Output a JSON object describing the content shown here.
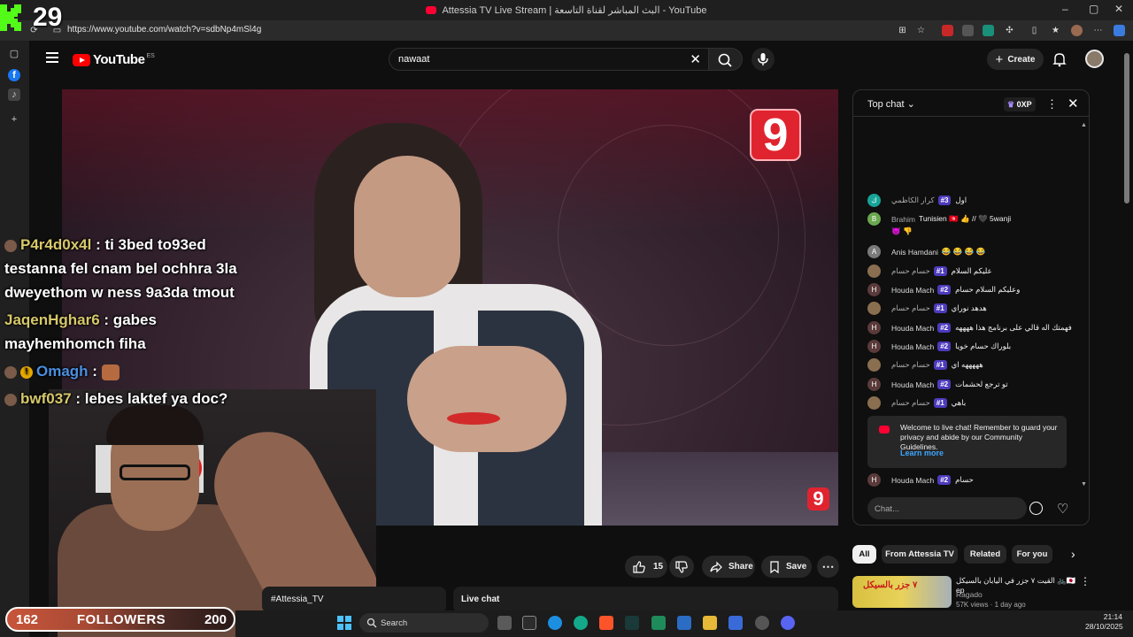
{
  "browser": {
    "tab_title": "Attessia TV Live Stream | البث المباشر لقناة التاسعة - YouTube",
    "url": "https://www.youtube.com/watch?v=sdbNp4mSl4g",
    "window_controls": [
      "–",
      "▢",
      "✕"
    ]
  },
  "youtube": {
    "logo_text": "YouTube",
    "region": "ES",
    "search_value": "nawaat",
    "create_label": "Create"
  },
  "video": {
    "channel_logo": "9"
  },
  "overlay": {
    "top_count": "29",
    "messages": [
      {
        "user": "P4r4d0x4l",
        "text": " : ti 3bed to93ed"
      },
      {
        "line": "testanna fel cnam bel ochhra 3la"
      },
      {
        "line": "dweyethom w ness 9a3da tmout"
      },
      {
        "user": "JaqenHghar6",
        "text": " : gabes"
      },
      {
        "line": "mayhemhomch fiha"
      },
      {
        "user": "Omagh",
        "text": " : "
      },
      {
        "user": "bwf037",
        "text": " : lebes laktef ya doc?"
      }
    ],
    "followers": {
      "current": "162",
      "label": "FOLLOWERS",
      "goal": "200"
    }
  },
  "below_video": {
    "like_count": "15",
    "share_label": "Share",
    "save_label": "Save",
    "hashtag": "#Attessia_TV",
    "live_chat_label": "Live chat"
  },
  "chat": {
    "mode_label": "Top chat",
    "xp_label": "0XP",
    "messages": [
      {
        "avatar": "ك",
        "avatar_color": "#17a398",
        "name": "كرار الكاظمي",
        "rank": "#3",
        "text": "اول"
      },
      {
        "avatar": "B",
        "avatar_color": "#6aa84f",
        "name": "Brahim",
        "rank": "",
        "text": "Tunisien 🇹🇳 👍 // 🖤 5wanji"
      },
      {
        "avatar": "",
        "avatar_color": "",
        "name": "",
        "rank": "",
        "text": "😈 👎"
      },
      {
        "avatar": "A",
        "avatar_color": "#7a7a7a",
        "name": "Anis Hamdani",
        "rank": "",
        "text": "😂 😂 😂 😂"
      },
      {
        "avatar": "",
        "avatar_color": "#8a6e50",
        "name": "حسام حسام",
        "rank": "#1",
        "text": "عليكم السلام"
      },
      {
        "avatar": "H",
        "avatar_color": "#5a3a3a",
        "name": "Houda Mach",
        "rank": "#2",
        "text": "وعليكم السلام حسام"
      },
      {
        "avatar": "",
        "avatar_color": "#8a6e50",
        "name": "حسام حسام",
        "rank": "#1",
        "text": "هدهد نوراي"
      },
      {
        "avatar": "H",
        "avatar_color": "#5a3a3a",
        "name": "Houda Mach",
        "rank": "#2",
        "text": "فهمتك اله قالي على برنامج هذا ههههه"
      },
      {
        "avatar": "H",
        "avatar_color": "#5a3a3a",
        "name": "Houda Mach",
        "rank": "#2",
        "text": "بلوراك حسام خويا"
      },
      {
        "avatar": "",
        "avatar_color": "#8a6e50",
        "name": "حسام حسام",
        "rank": "#1",
        "text": "هههههه اي"
      },
      {
        "avatar": "H",
        "avatar_color": "#5a3a3a",
        "name": "Houda Mach",
        "rank": "#2",
        "text": "تو ترجع لحشمات"
      },
      {
        "avatar": "",
        "avatar_color": "#8a6e50",
        "name": "حسام حسام",
        "rank": "#1",
        "text": "باهي"
      }
    ],
    "welcome_text": "Welcome to live chat! Remember to guard your privacy and abide by our Community Guidelines.",
    "learn_more": "Learn more",
    "last_message": {
      "avatar": "H",
      "name": "Houda Mach",
      "rank": "#2",
      "text": "حسام"
    },
    "input_placeholder": "Chat..."
  },
  "chips": [
    "All",
    "From Attessia TV",
    "Related",
    "For you"
  ],
  "recommended": {
    "thumb_text": "٧ جزر بالسيكل",
    "title": "القيت ٧ جزر في اليابان بالسيكل 🚲🇯🇵 ep",
    "channel": "Ragado",
    "meta": "57K views · 1 day ago"
  },
  "taskbar": {
    "search_label": "Search",
    "time": "21:14",
    "date": "28/10/2025"
  }
}
